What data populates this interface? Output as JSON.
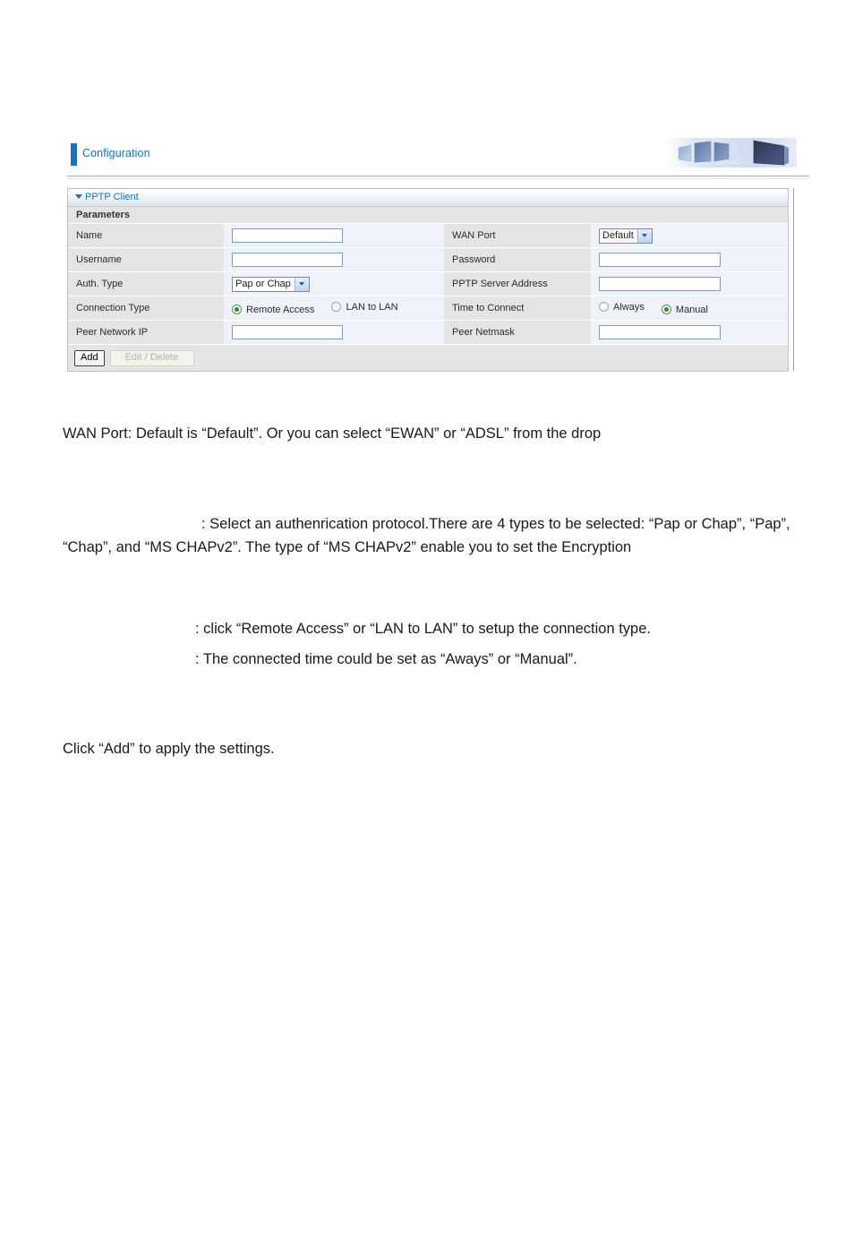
{
  "ui": {
    "header": {
      "title": "Configuration",
      "banner_icon": "monitors-banner-image"
    },
    "panel": {
      "title": "PPTP Client",
      "section_label": "Parameters",
      "rows": [
        {
          "left_label": "Name",
          "left_control": "text-input",
          "left_value": "",
          "right_label": "WAN Port",
          "right_control": "select",
          "right_value": "Default"
        },
        {
          "left_label": "Username",
          "left_control": "text-input",
          "left_value": "",
          "right_label": "Password",
          "right_control": "text-input",
          "right_value": ""
        },
        {
          "left_label": "Auth. Type",
          "left_control": "select",
          "left_value": "Pap or Chap",
          "right_label": "PPTP Server Address",
          "right_control": "text-input",
          "right_value": ""
        },
        {
          "left_label": "Connection Type",
          "left_control": "radio-group",
          "left_options": [
            "Remote Access",
            "LAN to LAN"
          ],
          "left_selected": "Remote Access",
          "right_label": "Time to Connect",
          "right_control": "radio-group",
          "right_options": [
            "Always",
            "Manual"
          ],
          "right_selected": "Manual"
        },
        {
          "left_label": "Peer Network IP",
          "left_control": "text-input",
          "left_value": "",
          "right_label": "Peer Netmask",
          "right_control": "text-input",
          "right_value": ""
        }
      ],
      "buttons": {
        "add_label": "Add",
        "edit_delete_label": "Edit / Delete",
        "edit_delete_disabled": true
      }
    },
    "colors": {
      "accent_blue": "#1273c4",
      "label_cell": "#e4e4e4",
      "value_cell": "#eef3fa",
      "radio_selected": "#2f8a2f",
      "input_border": "#7f9db9"
    }
  },
  "document": {
    "paragraphs": [
      {
        "id": "wan_port",
        "text": "WAN Port: Default is “Default”. Or you can select “EWAN” or “ADSL” from the drop"
      },
      {
        "id": "auth_type",
        "line1": ": Select an authenrication protocol.There are 4 types to be selected: “Pap or Chap”,",
        "line2": "“Pap”, “Chap”, and “MS CHAPv2”. The type of “MS CHAPv2” enable you to set the Encryption"
      },
      {
        "id": "connection_type",
        "text": ": click “Remote Access” or “LAN to LAN” to setup the connection type."
      },
      {
        "id": "time_to_connect",
        "text": ": The connected time could be set as “Aways” or “Manual”."
      },
      {
        "id": "apply",
        "text": "Click “Add” to apply the settings."
      }
    ]
  }
}
